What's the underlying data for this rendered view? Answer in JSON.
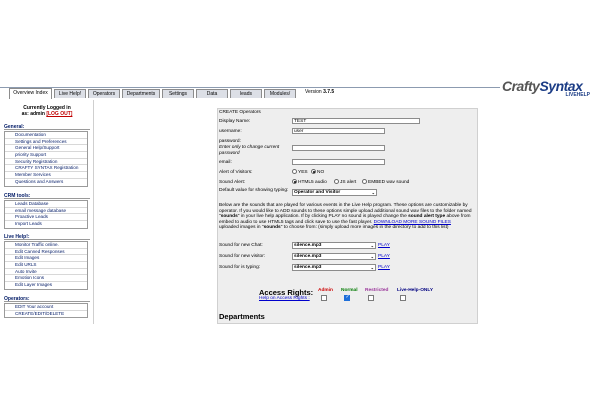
{
  "header": {
    "tabs": [
      {
        "label": "Overview Index",
        "active": true
      },
      {
        "label": "Live Help!",
        "active": false
      },
      {
        "label": "Operators",
        "active": false
      },
      {
        "label": "Departments",
        "active": false
      },
      {
        "label": "Settings",
        "active": false
      },
      {
        "label": "Data",
        "active": false
      },
      {
        "label": "leads",
        "active": false
      },
      {
        "label": "Modules/",
        "active": false
      }
    ],
    "version_label": "Version",
    "version_number": "3.7.5",
    "logo_crafty": "Crafty",
    "logo_syntax": "Syntax",
    "logo_sub": "LIVEHELP"
  },
  "sidebar": {
    "logged_in_line1": "Currently Logged in",
    "logged_in_line2": "as: admin",
    "logout_label": "[LOG OUT]",
    "sections": [
      {
        "title": "General:",
        "items": [
          "Documentation",
          "Settings and Preferences",
          "General Help/Support",
          "priority Support",
          "Security Registration",
          "CRAFTY SYNTAX Registration",
          "Member Services",
          "Questions and Answers"
        ]
      },
      {
        "title": "CRM tools:",
        "items": [
          "Leads Database",
          "email message database",
          "Proactive Leads",
          "Import Leads"
        ]
      },
      {
        "title": "Live Help!:",
        "items": [
          "Monitor Traffic online.",
          "Edit Canned Responses",
          "Edit Images",
          "Edit URLS",
          "Auto Invite",
          "Emotion Icons",
          "Edit Layer Images"
        ]
      },
      {
        "title": "Operators:",
        "items": [
          "EDIT Your account",
          "CREATE/EDIT/DELETE"
        ]
      }
    ]
  },
  "form": {
    "heading": "CREATE Operators",
    "display_name_label": "Display Name:",
    "display_name_value": "TEST",
    "username_label": "username:",
    "username_value": "user",
    "password_label": "password:",
    "password_hint": "Enter only to change current password",
    "email_label": "email:",
    "alert_label": "Alert of Visitors:",
    "alert_yes": "YES",
    "alert_no": "NO",
    "sound_alert_label": "Sound Alert:",
    "sound_opt1": "HTML5 audio",
    "sound_opt2": "JS alert",
    "sound_opt3": "EMBED wav sound",
    "default_label": "Default value for showing typing:",
    "default_value": "Operator and Visitor",
    "desc_part1": "Below are the sounds that are played for various events in the Live Help program. These options are customizable by operator. If you would like to ADD sounds to these options simple upload additional sound wav files to the folder named \"",
    "desc_bold1": "sounds",
    "desc_part2": "\" in your live help application. If by clicking PLAY no sound is played change the ",
    "desc_bold2": "sound alert type",
    "desc_part3": " above from embed to audio to use HTML5 tags and click save to use the fast player. ",
    "desc_link": "DOWNLOAD MORE SOUND FILES",
    "desc_part4": "uploaded images in \"",
    "desc_bold3": "sounds",
    "desc_part5": "\" to choose from: (simply upload more images in the directory to add to this list)",
    "sound_chat_label": "Sound for new Chat:",
    "sound_chat_value": "silence.mp3",
    "sound_visitor_label": "Sound for new visitor:",
    "sound_visitor_value": "silence.mp3",
    "sound_typing_label": "Sound for is typing:",
    "sound_typing_value": "silence.mp3",
    "play_label": "PLAY",
    "access_title": "Access Rights:",
    "access_help": "Help on Access Rights :",
    "access_cols": [
      {
        "label": "Admin",
        "color": "#cc0000",
        "checked": false
      },
      {
        "label": "Normal",
        "color": "#007a00",
        "checked": true
      },
      {
        "label": "Restricted",
        "color": "#993399",
        "checked": false
      },
      {
        "label": "Live-Help-ONLY",
        "color": "#000080",
        "checked": false
      }
    ],
    "departments_title": "Departments"
  }
}
